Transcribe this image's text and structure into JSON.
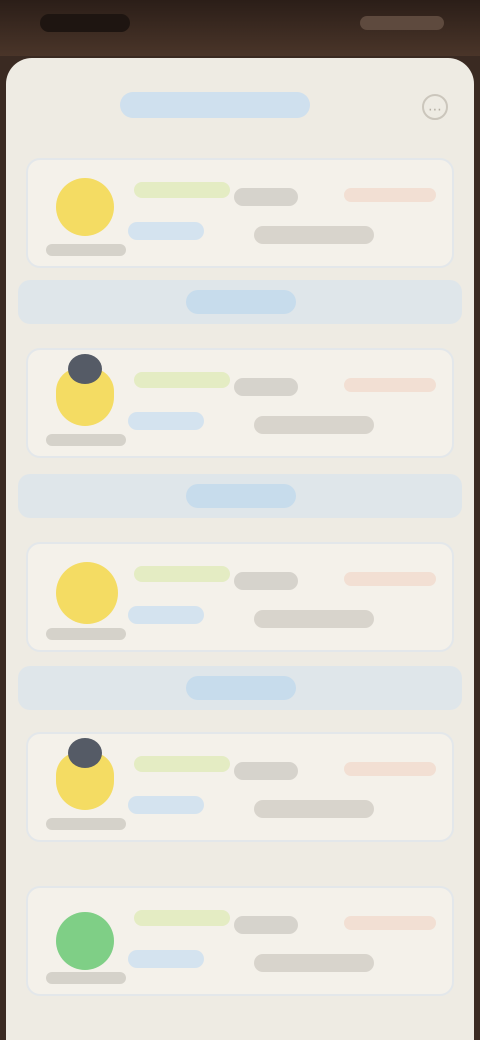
{
  "status_bar": {
    "time": ""
  },
  "header": {
    "title": "",
    "menu_icon": "ellipsis-icon"
  },
  "colors": {
    "accent_blue": "#c7dcec",
    "pet_yellow": "#f4dc63",
    "pet_green": "#7fcf86",
    "price_tint": "#f2dfd3"
  },
  "cards": [
    {
      "name": "",
      "tag": "",
      "value": "",
      "desc": "",
      "price": "",
      "avatar_color": "#f4dc63",
      "avatar_has_head": false
    },
    {
      "name": "",
      "tag": "",
      "value": "",
      "desc": "",
      "price": "",
      "avatar_color": "#f4dc63",
      "avatar_has_head": true
    },
    {
      "name": "",
      "tag": "",
      "value": "",
      "desc": "",
      "price": "",
      "avatar_color": "#f4dc63",
      "avatar_has_head": false
    },
    {
      "name": "",
      "tag": "",
      "value": "",
      "desc": "",
      "price": "",
      "avatar_color": "#f4dc63",
      "avatar_has_head": true
    },
    {
      "name": "",
      "tag": "",
      "value": "",
      "desc": "",
      "price": "",
      "avatar_color": "#7fcf86",
      "avatar_has_head": false
    }
  ],
  "dividers": [
    {
      "label": ""
    },
    {
      "label": ""
    },
    {
      "label": ""
    }
  ]
}
